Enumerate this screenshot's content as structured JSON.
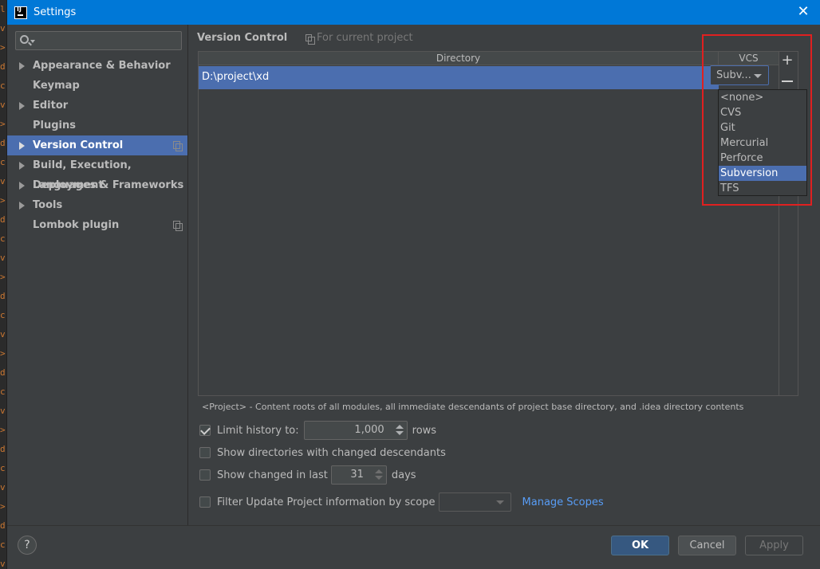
{
  "window": {
    "title": "Settings",
    "close_glyph": "✕"
  },
  "search": {
    "placeholder": ""
  },
  "sidebar": {
    "items": [
      {
        "label": "Appearance & Behavior",
        "expandable": true
      },
      {
        "label": "Keymap",
        "expandable": false
      },
      {
        "label": "Editor",
        "expandable": true
      },
      {
        "label": "Plugins",
        "expandable": false
      },
      {
        "label": "Version Control",
        "expandable": true,
        "selected": true
      },
      {
        "label": "Build, Execution, Deployment",
        "expandable": true
      },
      {
        "label": "Languages & Frameworks",
        "expandable": true
      },
      {
        "label": "Tools",
        "expandable": true
      },
      {
        "label": "Lombok plugin",
        "expandable": false
      }
    ]
  },
  "main": {
    "breadcrumb": "Version Control",
    "scope_note": "For current project",
    "table": {
      "col_directory": "Directory",
      "col_vcs": "VCS",
      "row_directory": "D:\\project\\xd",
      "row_vcs": "Subv..."
    },
    "add_glyph": "+",
    "vcs_options": [
      "<none>",
      "CVS",
      "Git",
      "Mercurial",
      "Perforce",
      "Subversion",
      "TFS"
    ],
    "vcs_selected": "Subversion",
    "project_note": "<Project> - Content roots of all modules, all immediate descendants of project base directory, and .idea directory contents",
    "options": {
      "limit_history_label": "Limit history to:",
      "limit_history_checked": true,
      "limit_history_value": "1,000",
      "limit_history_unit": "rows",
      "show_dirs_label": "Show directories with changed descendants",
      "show_changed_label": "Show changed in last",
      "show_changed_value": "31",
      "show_changed_unit": "days",
      "filter_label": "Filter Update Project information by scope",
      "manage_scopes": "Manage Scopes"
    }
  },
  "footer": {
    "help_glyph": "?",
    "ok": "OK",
    "cancel": "Cancel",
    "apply": "Apply"
  },
  "colors": {
    "accent": "#4b6eaf",
    "highlight": "#e02020",
    "titlebar": "#0078d7"
  }
}
